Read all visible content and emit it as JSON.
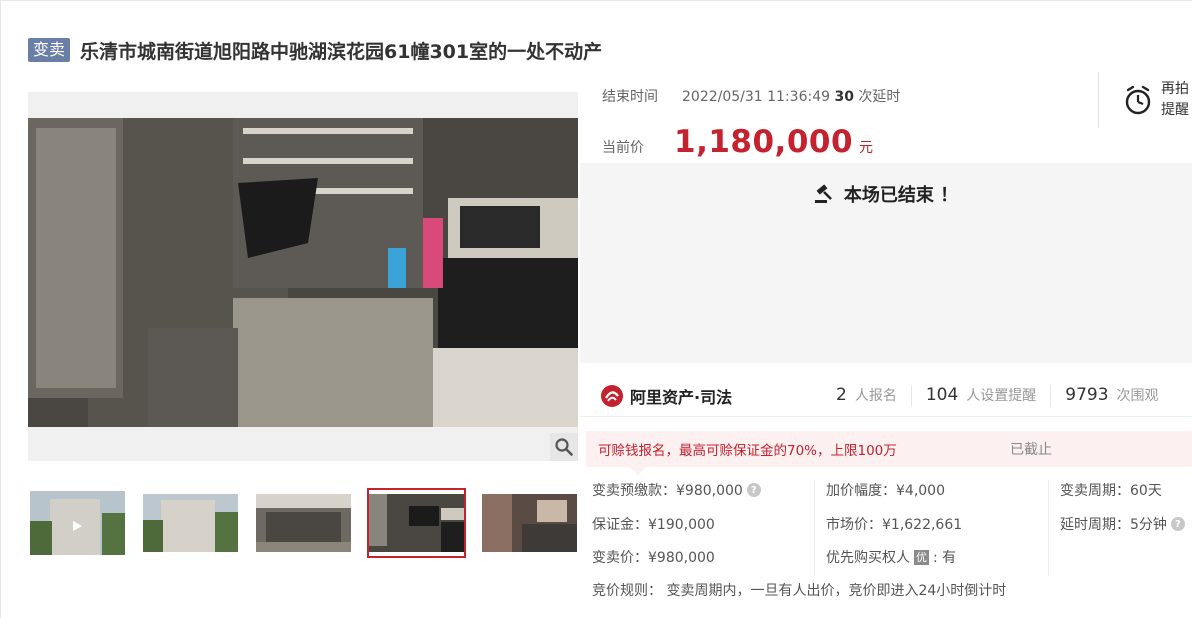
{
  "header": {
    "badge": "变卖",
    "title": "乐清市城南街道旭阳路中驰湖滨花园61幢301室的一处不动产"
  },
  "auction": {
    "end_label": "结束时间",
    "end_time": "2022/05/31 11:36:49",
    "delay_count": "30",
    "delay_suffix": "次延时",
    "remind_label": "再拍提醒",
    "price_label": "当前价",
    "price": "1,180,000",
    "price_unit": "元",
    "ended_text": "本场已结束 ！"
  },
  "stats": {
    "brand": "阿里资产·司法",
    "signups_num": "2",
    "signups_label": "人报名",
    "reminders_num": "104",
    "reminders_label": "人设置提醒",
    "views_num": "9793",
    "views_label": "次围观"
  },
  "notice": {
    "text": "可赊钱报名，最高可赊保证金的70%，上限100万",
    "status": "已截止"
  },
  "details": {
    "prepay": "变卖预缴款：¥980,000",
    "increment": "加价幅度：¥4,000",
    "period": "变卖周期：60天",
    "deposit": "保证金：¥190,000",
    "market_price": "市场价：¥1,622,661",
    "delay_period": "延时周期：5分钟",
    "sale_price": "变卖价：¥980,000",
    "priority_label": "优先购买权人",
    "priority_badge": "优",
    "priority_value": ": 有",
    "rule": "竞价规则： 变卖周期内，一旦有人出价，竞价即进入24小时倒计时"
  },
  "colors": {
    "accent": "#c4222e",
    "badge": "#6a7fa5",
    "notice_bg": "#fdf0f0"
  },
  "icons": [
    "alarm-clock-icon",
    "gavel-icon",
    "search-icon",
    "play-icon",
    "alibaba-logo-icon",
    "help-icon"
  ]
}
